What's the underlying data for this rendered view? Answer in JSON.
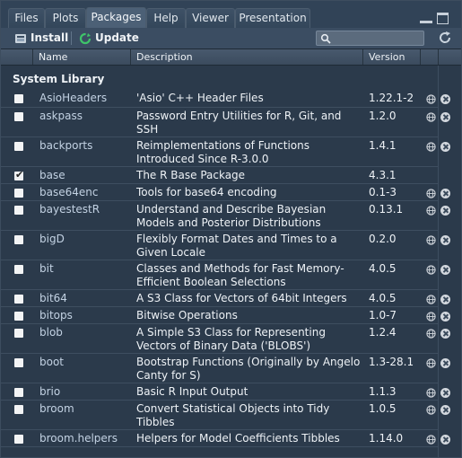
{
  "tabs": [
    {
      "label": "Files",
      "active": false
    },
    {
      "label": "Plots",
      "active": false
    },
    {
      "label": "Packages",
      "active": true
    },
    {
      "label": "Help",
      "active": false
    },
    {
      "label": "Viewer",
      "active": false
    },
    {
      "label": "Presentation",
      "active": false
    }
  ],
  "toolbar": {
    "install_label": "Install",
    "update_label": "Update",
    "search_placeholder": ""
  },
  "columns": {
    "name": "Name",
    "description": "Description",
    "version": "Version"
  },
  "section_label": "System Library",
  "packages": [
    {
      "name": "AsioHeaders",
      "desc": "'Asio' C++ Header Files",
      "ver": "1.22.1-2",
      "checked": false,
      "has_web": true,
      "has_del": true
    },
    {
      "name": "askpass",
      "desc": "Password Entry Utilities for R, Git, and SSH",
      "ver": "1.2.0",
      "checked": false,
      "has_web": true,
      "has_del": true
    },
    {
      "name": "backports",
      "desc": "Reimplementations of Functions Introduced Since R-3.0.0",
      "ver": "1.4.1",
      "checked": false,
      "has_web": true,
      "has_del": true
    },
    {
      "name": "base",
      "desc": "The R Base Package",
      "ver": "4.3.1",
      "checked": true,
      "has_web": false,
      "has_del": false
    },
    {
      "name": "base64enc",
      "desc": "Tools for base64 encoding",
      "ver": "0.1-3",
      "checked": false,
      "has_web": true,
      "has_del": true
    },
    {
      "name": "bayestestR",
      "desc": "Understand and Describe Bayesian Models and Posterior Distributions",
      "ver": "0.13.1",
      "checked": false,
      "has_web": true,
      "has_del": true
    },
    {
      "name": "bigD",
      "desc": "Flexibly Format Dates and Times to a Given Locale",
      "ver": "0.2.0",
      "checked": false,
      "has_web": true,
      "has_del": true
    },
    {
      "name": "bit",
      "desc": "Classes and Methods for Fast Memory-Efficient Boolean Selections",
      "ver": "4.0.5",
      "checked": false,
      "has_web": true,
      "has_del": true
    },
    {
      "name": "bit64",
      "desc": "A S3 Class for Vectors of 64bit Integers",
      "ver": "4.0.5",
      "checked": false,
      "has_web": true,
      "has_del": true
    },
    {
      "name": "bitops",
      "desc": "Bitwise Operations",
      "ver": "1.0-7",
      "checked": false,
      "has_web": true,
      "has_del": true
    },
    {
      "name": "blob",
      "desc": "A Simple S3 Class for Representing Vectors of Binary Data ('BLOBS')",
      "ver": "1.2.4",
      "checked": false,
      "has_web": true,
      "has_del": true
    },
    {
      "name": "boot",
      "desc": "Bootstrap Functions (Originally by Angelo Canty for S)",
      "ver": "1.3-28.1",
      "checked": false,
      "has_web": true,
      "has_del": true
    },
    {
      "name": "brio",
      "desc": "Basic R Input Output",
      "ver": "1.1.3",
      "checked": false,
      "has_web": true,
      "has_del": true
    },
    {
      "name": "broom",
      "desc": "Convert Statistical Objects into Tidy Tibbles",
      "ver": "1.0.5",
      "checked": false,
      "has_web": true,
      "has_del": true
    },
    {
      "name": "broom.helpers",
      "desc": "Helpers for Model Coefficients Tibbles",
      "ver": "1.14.0",
      "checked": false,
      "has_web": true,
      "has_del": true
    }
  ]
}
